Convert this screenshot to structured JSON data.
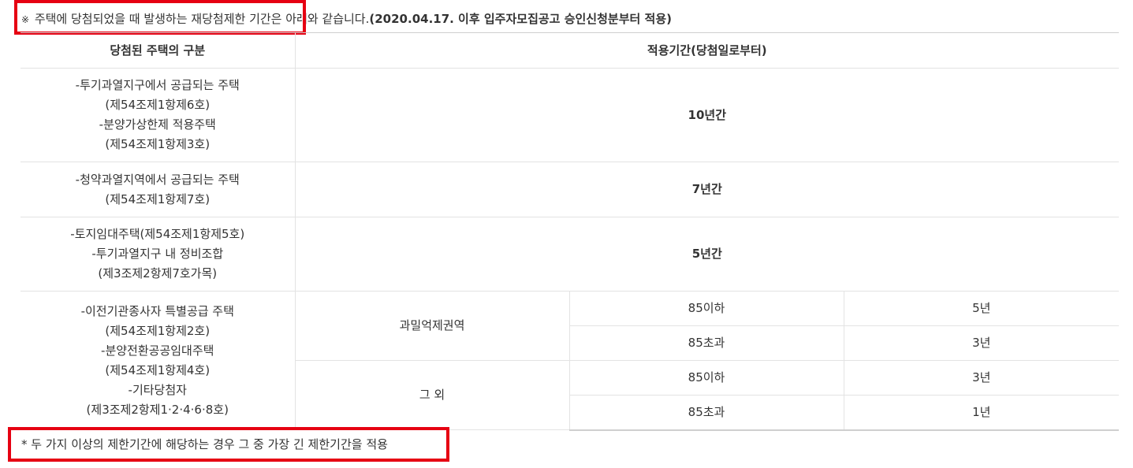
{
  "notice_top": {
    "mark": "※",
    "text": " 주택에 당첨되었을 때 발생하는 재당첨제한 기간은 아래와 같습니다.",
    "bold": "(2020.04.17. 이후 입주자모집공고 승인신청분부터 적용)"
  },
  "table": {
    "headers": [
      "당첨된 주택의 구분",
      "적용기간(당첨일로부터)"
    ],
    "rows": [
      {
        "type": "-투기과열지구에서 공급되는 주택\n(제54조제1항제6호)\n-분양가상한제 적용주택\n(제54조제1항제3호)",
        "period": "10년간"
      },
      {
        "type": "-청약과열지역에서 공급되는 주택\n(제54조제1항제7호)",
        "period": "7년간"
      },
      {
        "type": "-토지임대주택(제54조제1항제5호)\n-투기과열지구 내 정비조합\n(제3조제2항제7호가목)",
        "period": "5년간"
      }
    ],
    "last_group": {
      "type": "-이전기관종사자 특별공급 주택\n(제54조제1항제2호)\n-분양전환공공임대주택\n(제54조제1항제4호)\n-기타당첨자\n(제3조제2항제1·2·4·6·8호)",
      "regions": [
        {
          "name": "과밀억제권역",
          "sizes": [
            {
              "size": "85이하",
              "period": "5년"
            },
            {
              "size": "85초과",
              "period": "3년"
            }
          ]
        },
        {
          "name": "그 외",
          "sizes": [
            {
              "size": "85이하",
              "period": "3년"
            },
            {
              "size": "85초과",
              "period": "1년"
            }
          ]
        }
      ]
    }
  },
  "notice_bottom": "* 두 가지 이상의 제한기간에 해당하는 경우 그 중 가장 긴 제한기간을 적용",
  "colors": {
    "highlight_box": "#e60012",
    "text": "#333333",
    "border": "#e3e3e3"
  }
}
